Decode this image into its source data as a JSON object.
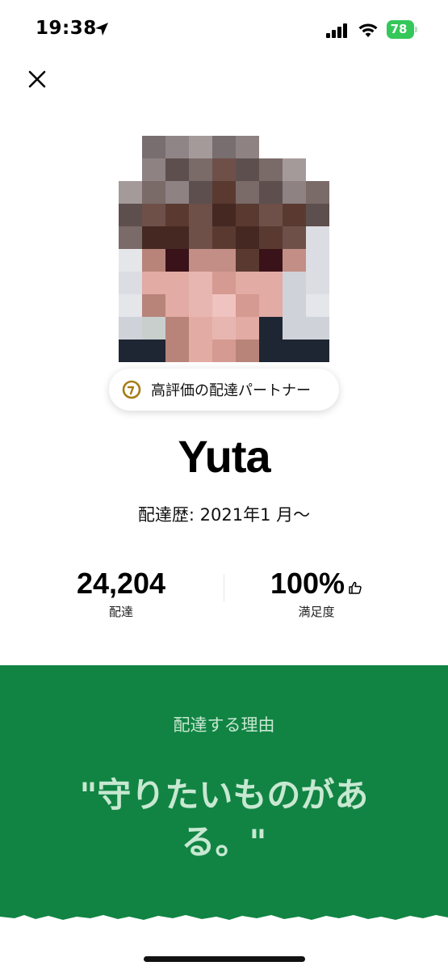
{
  "status_bar": {
    "time": "19:38",
    "battery": "78",
    "icons": [
      "location-arrow-icon",
      "signal-icon",
      "wifi-icon",
      "battery-icon"
    ]
  },
  "header": {
    "close_icon": "close-icon"
  },
  "profile": {
    "badge_label": "高評価の配達パートナー",
    "badge_icon": "rating-badge-icon",
    "name": "Yuta",
    "since": "配達歴: 2021年1 月〜"
  },
  "stats": {
    "deliveries_value": "24,204",
    "deliveries_label": "配達",
    "satisfaction_value": "100%",
    "satisfaction_label": "満足度",
    "satisfaction_icon": "thumbs-up-icon"
  },
  "reason": {
    "title": "配達する理由",
    "quote": "\"守りたいものがある。\""
  },
  "colors": {
    "accent_green": "#118443",
    "reason_text": "#c7e8d1",
    "battery_green": "#34c759"
  }
}
